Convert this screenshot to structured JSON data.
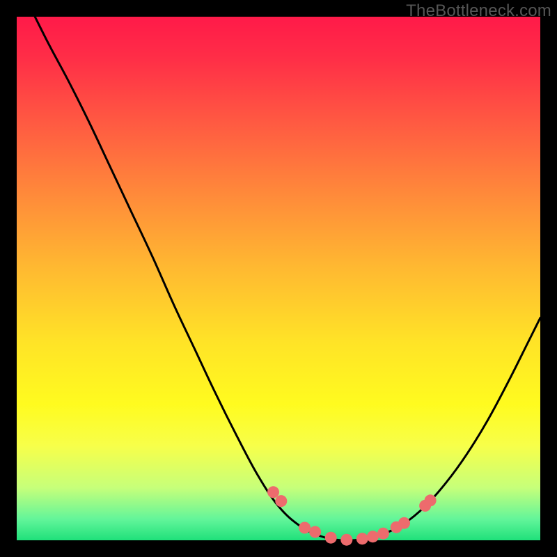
{
  "watermark": "TheBottleneck.com",
  "chart_data": {
    "type": "line",
    "title": "",
    "xlabel": "",
    "ylabel": "",
    "xlim": [
      0,
      100
    ],
    "ylim": [
      0,
      100
    ],
    "series": [
      {
        "name": "bottleneck-curve",
        "x": [
          2,
          6,
          10,
          14,
          18,
          22,
          26,
          30,
          34,
          38,
          42,
          46,
          50,
          54,
          58,
          62,
          66,
          70,
          74,
          78,
          82,
          86,
          90,
          94,
          98,
          100
        ],
        "y": [
          103,
          95,
          87.5,
          79.5,
          71,
          62.5,
          54,
          45,
          36.5,
          28,
          20,
          12.5,
          6.5,
          2.8,
          0.8,
          0.0,
          0.2,
          1.2,
          3.2,
          6.5,
          11,
          16.5,
          23,
          30.5,
          38.5,
          42.5
        ]
      }
    ],
    "markers": {
      "name": "highlight-points",
      "x": [
        49,
        50.5,
        55,
        57,
        60,
        63,
        66,
        68,
        70,
        72.5,
        74,
        78,
        79
      ],
      "y": [
        9.2,
        7.5,
        2.4,
        1.6,
        0.5,
        0.1,
        0.3,
        0.7,
        1.3,
        2.5,
        3.3,
        6.6,
        7.6
      ]
    },
    "colors": {
      "curve": "#000000",
      "marker": "#ed6b6d",
      "gradient_top": "#ff1a49",
      "gradient_mid": "#ffe327",
      "gradient_bottom": "#1fe07a"
    }
  }
}
